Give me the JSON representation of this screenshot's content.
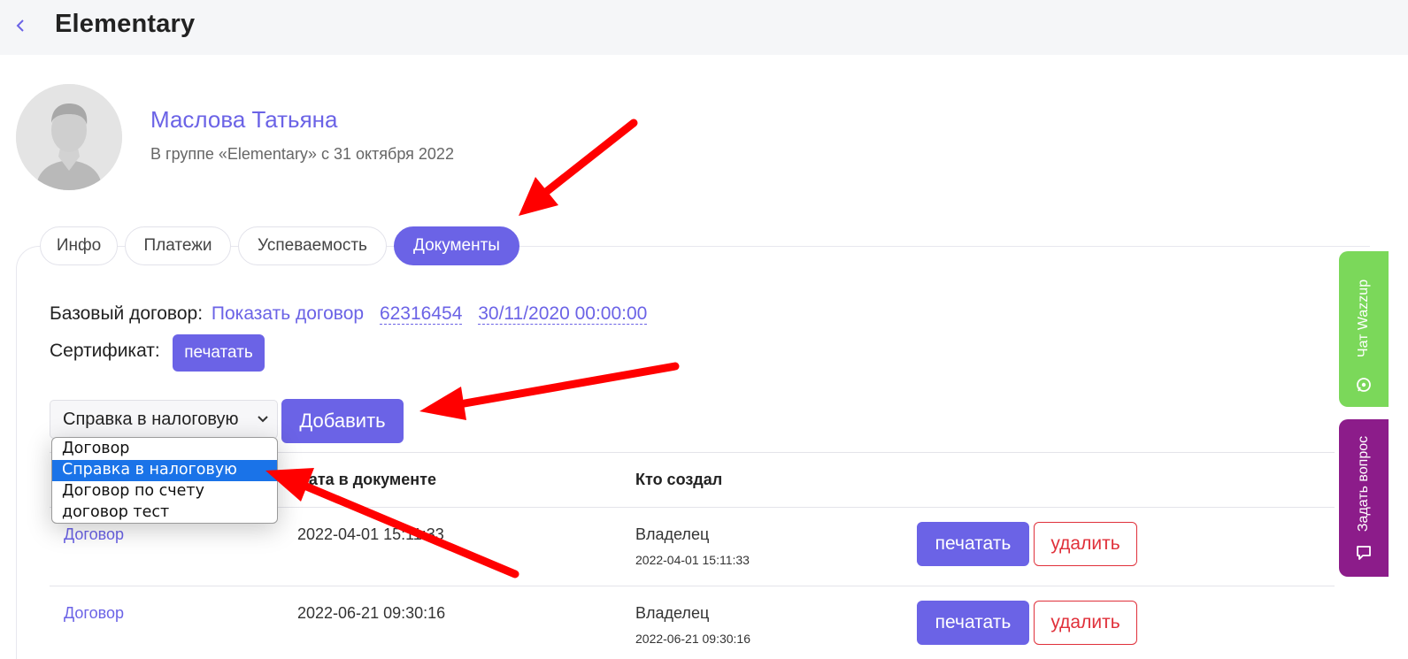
{
  "header": {
    "title": "Elementary"
  },
  "profile": {
    "name": "Маслова Татьяна",
    "subtitle": "В группе «Elementary» с 31 октября 2022"
  },
  "tabs": [
    {
      "label": "Инфо",
      "active": false
    },
    {
      "label": "Платежи",
      "active": false
    },
    {
      "label": "Успеваемость",
      "active": false
    },
    {
      "label": "Документы",
      "active": true
    }
  ],
  "contract": {
    "label": "Базовый договор:",
    "show_link": "Показать договор",
    "number": "62316454",
    "date": "30/11/2020 00:00:00"
  },
  "certificate": {
    "label": "Сертификат:",
    "print_label": "печатать"
  },
  "add_doc": {
    "selected": "Справка в налоговую",
    "options": [
      "Договор",
      "Справка в налоговую",
      "Договор по счету",
      "договор тест"
    ],
    "add_label": "Добавить"
  },
  "table": {
    "columns": [
      "Дата в документе",
      "Кто создал"
    ],
    "rows": [
      {
        "doc": "Договор",
        "date": "2022-04-01 15:11:33",
        "creator": "Владелец",
        "created_at": "2022-04-01 15:11:33",
        "print_label": "печатать",
        "delete_label": "удалить"
      },
      {
        "doc": "Договор",
        "date": "2022-06-21 09:30:16",
        "creator": "Владелец",
        "created_at": "2022-06-21 09:30:16",
        "print_label": "печатать",
        "delete_label": "удалить"
      }
    ]
  },
  "widgets": {
    "wazzup": "Чат Wazzup",
    "ask": "Задать вопрос"
  },
  "colors": {
    "accent": "#6b63e6",
    "danger": "#e0303a",
    "annotation": "#ff0000",
    "wazzup": "#7bd85a",
    "ask": "#8c1c8a"
  },
  "icons": [
    "chevron-left-icon",
    "chevron-down-icon",
    "whatsapp-icon",
    "chat-bubble-icon"
  ]
}
